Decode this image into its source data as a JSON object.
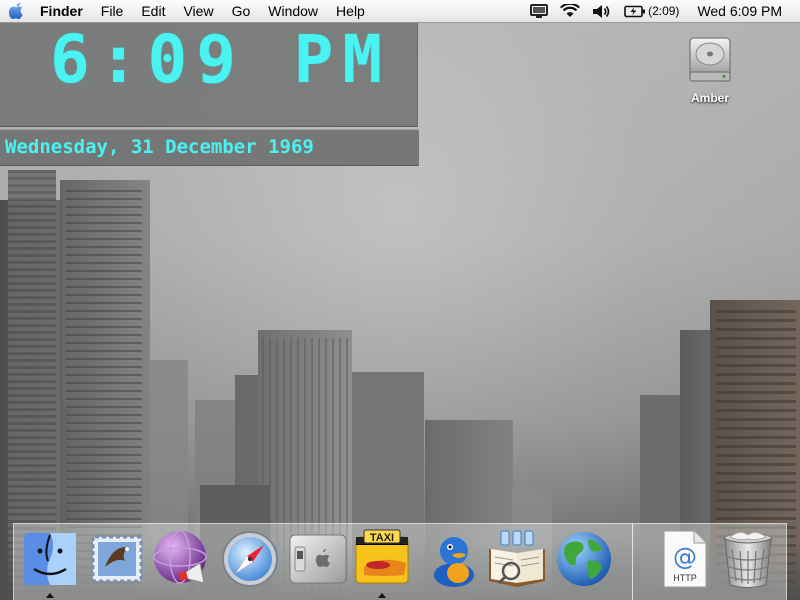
{
  "menubar": {
    "app_name": "Finder",
    "items": [
      "File",
      "Edit",
      "View",
      "Go",
      "Window",
      "Help"
    ],
    "battery_text": "(2:09)",
    "clock": "Wed 6:09 PM"
  },
  "widget": {
    "time": "6:09 PM",
    "date": "Wednesday, 31 December 1969",
    "text_color": "#4af2f2"
  },
  "desktop": {
    "icons": [
      {
        "label": "Amber",
        "icon": "hard-drive-icon"
      }
    ]
  },
  "dock": {
    "items": [
      {
        "icon": "finder-icon",
        "running": true
      },
      {
        "icon": "mail-icon",
        "running": false
      },
      {
        "icon": "adium-like-icon",
        "running": false
      },
      {
        "icon": "safari-icon",
        "running": false
      },
      {
        "icon": "system-preferences-icon",
        "running": false
      },
      {
        "icon": "taxi-app-icon",
        "running": true
      },
      {
        "icon": "duck-app-icon",
        "running": false
      },
      {
        "icon": "dictionary-icon",
        "running": false
      },
      {
        "icon": "globe-icon",
        "running": false
      },
      {
        "icon": "http-document-icon",
        "label": "HTTP",
        "running": false
      },
      {
        "icon": "trash-icon",
        "running": false
      }
    ]
  }
}
